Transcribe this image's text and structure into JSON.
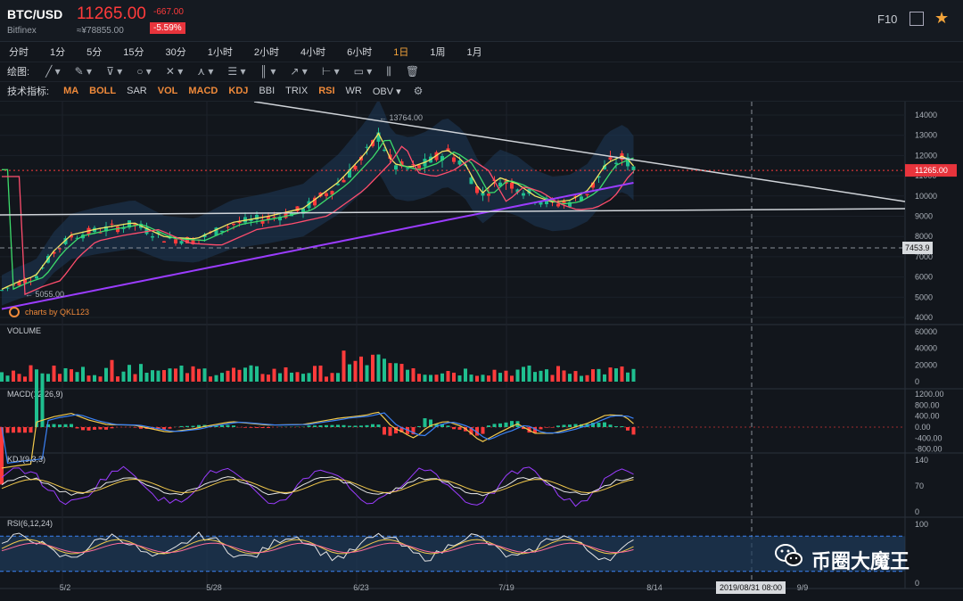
{
  "header": {
    "pair": "BTC/USD",
    "exchange": "Bitfinex",
    "price": "11265.00",
    "change": "-667.00",
    "change_pct": "-5.59%",
    "cny": "≈¥78855.00",
    "f10": "F10",
    "price_color": "#ff3b3b"
  },
  "timeframes": [
    "分时",
    "1分",
    "5分",
    "15分",
    "30分",
    "1小时",
    "2小时",
    "4小时",
    "6小时",
    "1日",
    "1周",
    "1月"
  ],
  "active_timeframe": "1日",
  "draw_label": "绘图:",
  "indicator_label": "技术指标:",
  "indicators": [
    "MA",
    "BOLL",
    "SAR",
    "VOL",
    "MACD",
    "KDJ",
    "BBI",
    "TRIX",
    "RSI",
    "WR",
    "OBV"
  ],
  "main": {
    "price_ticks": [
      "14000",
      "13000",
      "12000",
      "11000",
      "10000",
      "9000",
      "8000",
      "7000",
      "6000",
      "5000",
      "4000"
    ],
    "high_label": "← 13764.00",
    "low_label": "← 5055.00",
    "current_price_tag": "11265.00",
    "crosshair_price_tag": "7453.9",
    "watermark": "charts by QKL123"
  },
  "volume": {
    "label": "VOLUME",
    "ticks": [
      "60000",
      "40000",
      "20000",
      "0"
    ]
  },
  "macd": {
    "label": "MACD(12,26,9)",
    "ticks": [
      "1200.00",
      "800.00",
      "400.00",
      "0.00",
      "-400.00",
      "-800.00"
    ]
  },
  "kdj": {
    "label": "KDJ(9,3,3)",
    "ticks": [
      "140",
      "70",
      "0"
    ]
  },
  "rsi": {
    "label": "RSI(6,12,24)",
    "ticks": [
      "100",
      "0"
    ]
  },
  "x_axis": {
    "dates": [
      "5/2",
      "5/28",
      "6/23",
      "7/19",
      "8/14",
      "9/9"
    ],
    "crosshair_date": "2019/08/31 08:00"
  },
  "brand_watermark": "币圈大魔王",
  "colors": {
    "up": "#1fbf8f",
    "down": "#ff3b3b",
    "accent": "#f2a33a"
  }
}
